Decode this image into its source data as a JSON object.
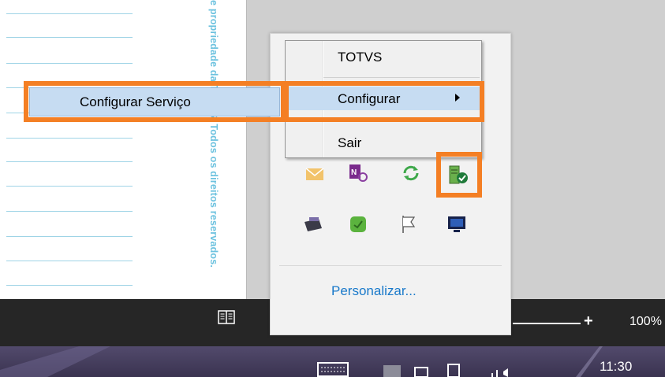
{
  "document": {
    "vertical_text": "e propriedade da TOTVS. Todos os direitos reservados."
  },
  "status_bar": {
    "zoom_plus": "+",
    "zoom_level": "100%"
  },
  "taskbar": {
    "clock": "11:30"
  },
  "context_menu": {
    "items": [
      {
        "label": "TOTVS"
      },
      {
        "label": "Configurar"
      },
      {
        "label": "Sair"
      }
    ]
  },
  "submenu": {
    "item": "Configurar Serviço"
  },
  "tray": {
    "icons": [
      "mail-icon",
      "onenote-icon",
      "sync-icon",
      "totvs-service-icon",
      "video-icon",
      "evernote-icon",
      "flag-icon",
      "display-icon"
    ],
    "customize_link": "Personalizar..."
  },
  "colors": {
    "highlight_orange": "#f47f24",
    "menu_hover": "#c6dcf2",
    "link_blue": "#1979ca"
  }
}
